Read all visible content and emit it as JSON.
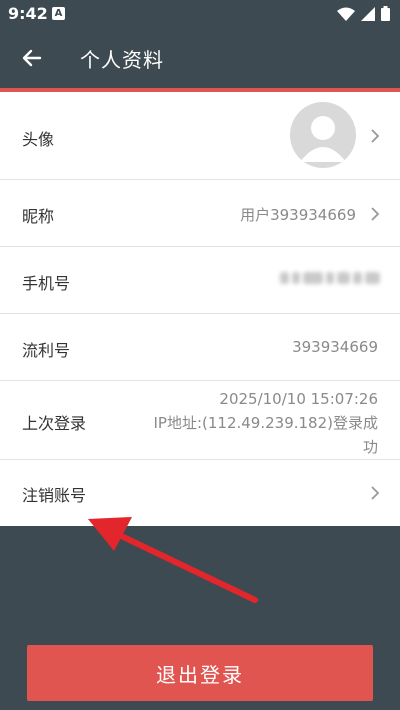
{
  "status": {
    "time": "9:42",
    "notif": "A"
  },
  "header": {
    "title": "个人资料"
  },
  "profile": {
    "avatar_label": "头像",
    "nickname_label": "昵称",
    "nickname_value": "用户393934669",
    "phone_label": "手机号",
    "id_label": "流利号",
    "id_value": "393934669",
    "last_login_label": "上次登录",
    "last_login_time": "2025/10/10 15:07:26",
    "last_login_ip": "IP地址:(112.49.239.182)登录成",
    "last_login_tail": "功",
    "cancel_account_label": "注销账号"
  },
  "actions": {
    "logout": "退出登录"
  },
  "colors": {
    "bar": "#3d4a52",
    "accent": "#e05550"
  }
}
